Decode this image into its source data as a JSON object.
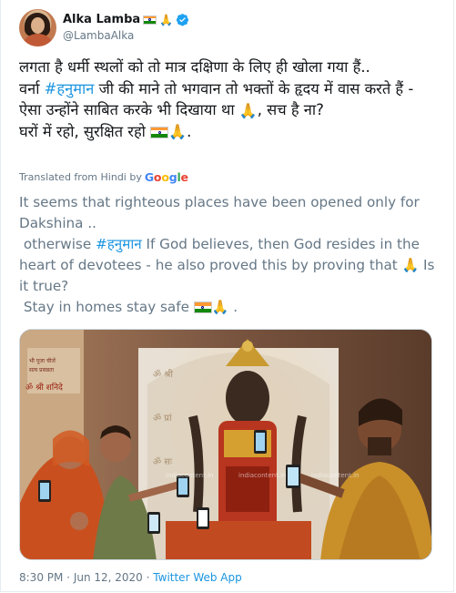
{
  "tweet": {
    "display_name": "Alka Lamba",
    "handle": "@LambaAlka",
    "original_text_1": "लगता है धर्मी स्थलों को तो मात्र दक्षिणा के लिए ही खोला गया हैं..\nवर्ना ",
    "hashtag_hi": "#हनुमान",
    "original_text_2": " जी की माने तो भगवान तो भक्तों के हृदय में वास करते हैं - ऐसा उन्होंने साबित करके भी दिखाया था ",
    "original_text_3": ", सच है ना?\nघरों में रहो, सुरक्षित रहो ",
    "original_text_4": ".",
    "translated_label": "Translated from Hindi by",
    "translated_provider": "Google",
    "translation_1": "It seems that righteous places have been opened only for Dakshina ..\n otherwise ",
    "translation_hashtag": "#हनुमान",
    "translation_2": " If God believes, then God resides in the heart of devotees - he also proved this by proving that ",
    "translation_3": " Is it true?\n Stay in homes stay safe ",
    "translation_4": " .",
    "time": "8:30 PM",
    "separator_1": " · ",
    "date": "Jun 12, 2020",
    "separator_2": " · ",
    "source": "Twitter Web App",
    "photo_watermark": "indiacontent.in",
    "photo_sign_text": "ॐ श्री शनिदे"
  },
  "icons": {
    "verified": "verified-badge-icon",
    "flag": "india-flag-icon",
    "pray": "folded-hands-icon"
  },
  "colors": {
    "link": "#1b95e0",
    "text": "#14171a",
    "muted": "#657786",
    "verified": "#1da1f2",
    "google_blue": "#4285f4",
    "google_red": "#ea4335",
    "google_yellow": "#fbbc05",
    "google_green": "#34a853"
  }
}
